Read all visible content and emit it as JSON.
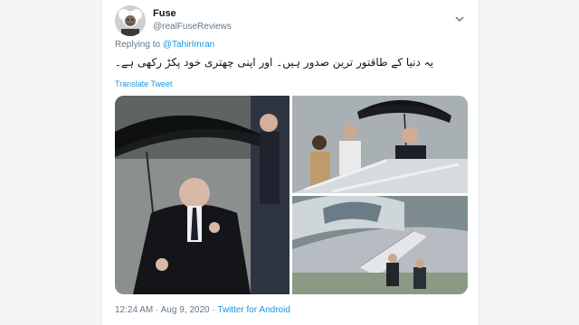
{
  "tweet": {
    "display_name": "Fuse",
    "handle": "@realFuseReviews",
    "replying_prefix": "Replying to",
    "reply_to": "@TahirImran",
    "text": "یہ دنیا کے طاقتور ترین صدور ہیں۔ اور اپنی چھتری خود پکڑ رکھی ہے۔",
    "translate_label": "Translate Tweet",
    "time": "12:24 AM",
    "separator": "·",
    "date": "Aug 9, 2020",
    "source": "Twitter for Android"
  },
  "icons": {
    "more": "chevron-down-icon",
    "avatar": "avatar-portrait"
  },
  "colors": {
    "link": "#1b95e0",
    "muted": "#657786",
    "text": "#14171a",
    "page_bg": "#f3f4f5"
  },
  "media": {
    "image_count": 3
  }
}
